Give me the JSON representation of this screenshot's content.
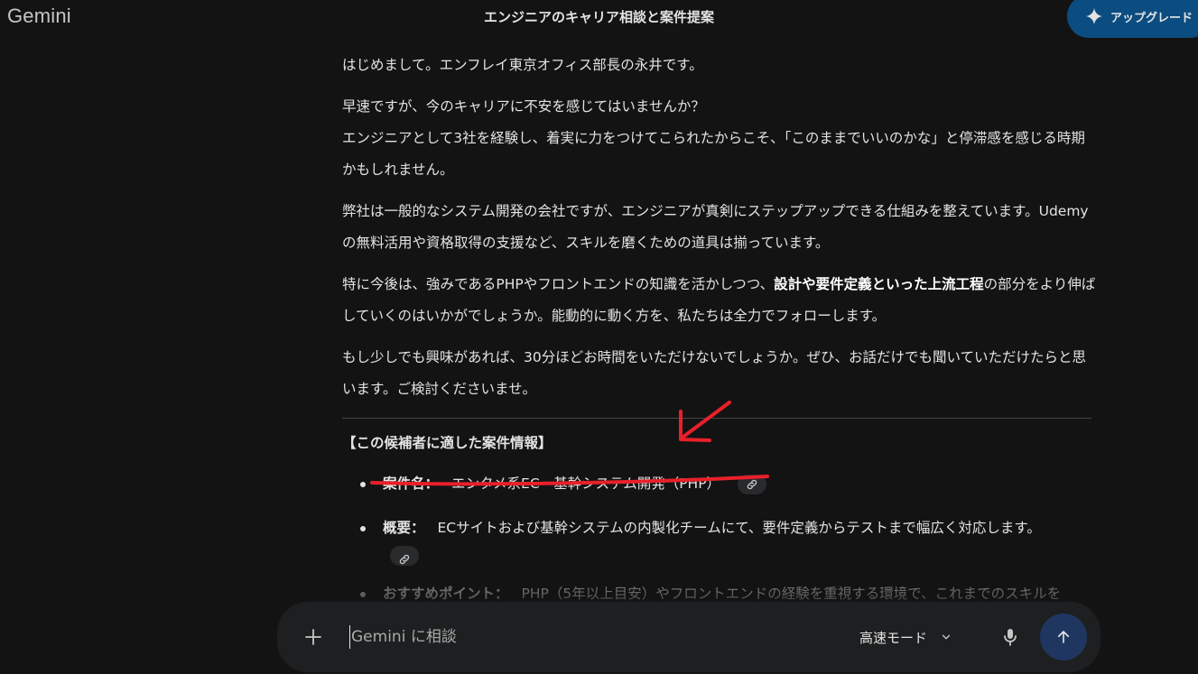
{
  "app": {
    "logo": "Gemini",
    "chat_title": "エンジニアのキャリア相談と案件提案"
  },
  "header": {
    "upgrade_label": "アップグレード",
    "upgrade_icon": "sparkle-icon"
  },
  "message": {
    "p1": "はじめまして。エンフレイ東京オフィス部長の永井です。",
    "p2_line1": "早速ですが、今のキャリアに不安を感じてはいませんか？",
    "p2_line2": "エンジニアとして3社を経験し、着実に力をつけてこられたからこそ、「このままでいいのかな」と停滞感を感じる時期かもしれません。",
    "p3": "弊社は一般的なシステム開発の会社ですが、エンジニアが真剣にステップアップできる仕組みを整えています。Udemyの無料活用や資格取得の支援など、スキルを磨くための道具は揃っています。",
    "p4_before": "特に今後は、強みであるPHPやフロントエンドの知識を活かしつつ、",
    "p4_bold": "設計や要件定義といった上流工程",
    "p4_after": "の部分をより伸ばしていくのはいかがでしょうか。能動的に動く方を、私たちは全力でフォローします。",
    "p5": "もし少しでも興味があれば、30分ほどお時間をいただけないでしょうか。ぜひ、お話だけでも聞いていただけたらと思います。ご検討くださいませ。"
  },
  "cases": {
    "heading": "【この候補者に適した案件情報】",
    "items": [
      {
        "key": "案件名：",
        "value": "エンタメ系EC・基幹システム開発（PHP）"
      },
      {
        "key": "概要：",
        "value": "ECサイトおよび基幹システムの内製化チームにて、要件定義からテストまで幅広く対応します。"
      },
      {
        "key": "おすすめポイント：",
        "value": "PHP（5年以上目安）やフロントエンドの経験を重視する環境で、これまでのスキルを"
      }
    ]
  },
  "input_bar": {
    "placeholder": "Gemini に相談",
    "mode_label": "高速モード"
  },
  "colors": {
    "background": "#131314",
    "upgrade_button": "#0b4d81",
    "send_button": "#1f3760",
    "annotation_red": "#e8202a"
  }
}
